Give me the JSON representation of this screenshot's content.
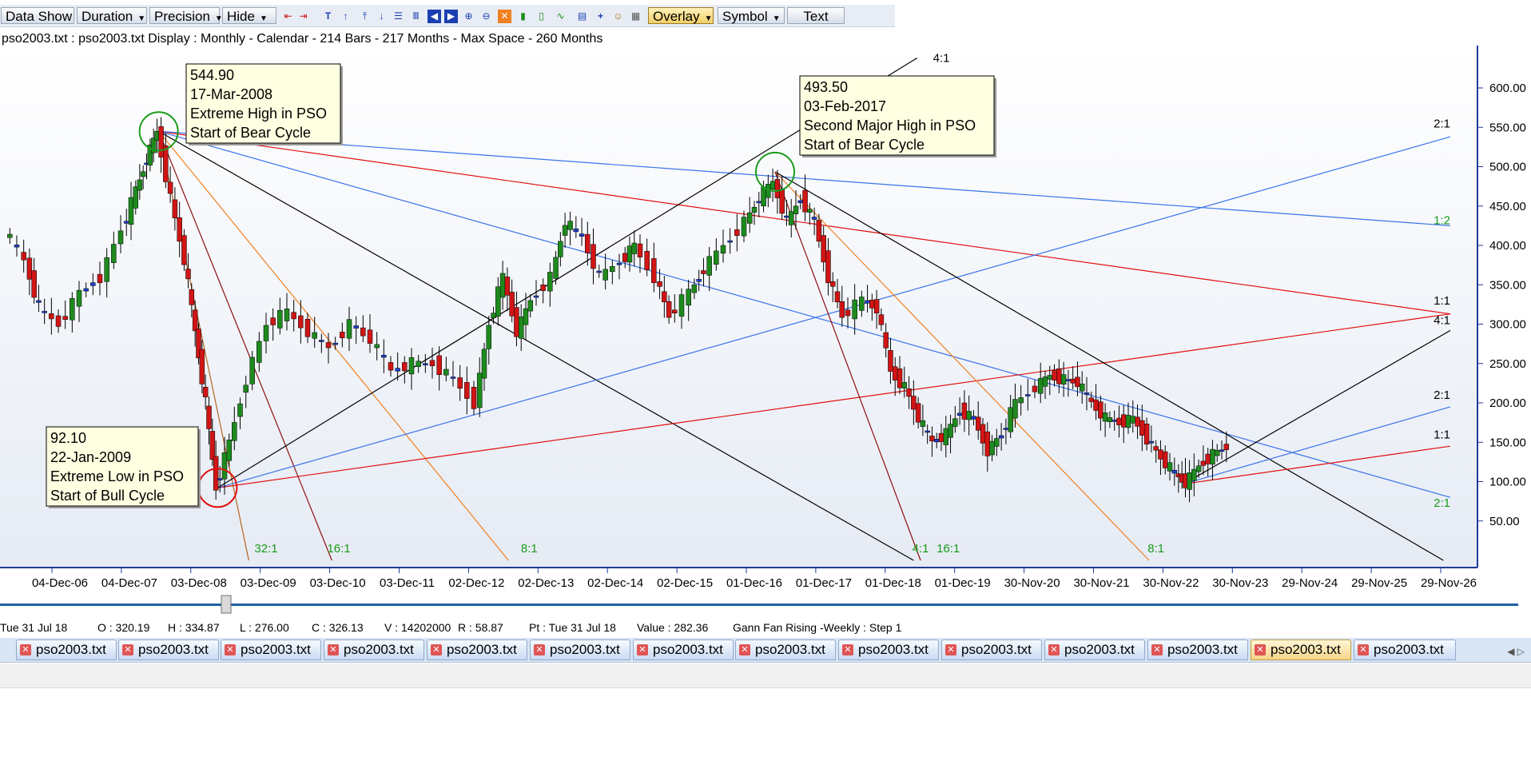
{
  "toolbar": {
    "data_show": "Data Show",
    "duration": "Duration",
    "precision": "Precision",
    "hide": "Hide",
    "overlay": "Overlay",
    "symbol": "Symbol",
    "text": "Text"
  },
  "info_line": "pso2003.txt : pso2003.txt Display :  Monthly  - Calendar - 214 Bars - 217 Months -  Max Space - 260 Months",
  "status": {
    "date": "Tue 31 Jul 18",
    "open": "O : 320.19",
    "high": "H : 334.87",
    "low": "L : 276.00",
    "close": "C : 326.13",
    "volume": "V : 14202000",
    "range": "R : 58.87",
    "pt": "Pt : Tue 31 Jul 18",
    "value": "Value : 282.36",
    "tool": "Gann Fan Rising -Weekly : Step 1"
  },
  "tabs": [
    "pso2003.txt",
    "pso2003.txt",
    "pso2003.txt",
    "pso2003.txt",
    "pso2003.txt",
    "pso2003.txt",
    "pso2003.txt",
    "pso2003.txt",
    "pso2003.txt",
    "pso2003.txt",
    "pso2003.txt",
    "pso2003.txt",
    "pso2003.txt",
    "pso2003.txt"
  ],
  "active_tab_index": 12,
  "chart_data": {
    "type": "candlestick",
    "symbol": "PSO",
    "ylim": [
      0,
      620
    ],
    "y_ticks": [
      50,
      100,
      150,
      200,
      250,
      300,
      350,
      400,
      450,
      500,
      550,
      600
    ],
    "y_tick_labels": [
      "50.00",
      "100.00",
      "150.00",
      "200.00",
      "250.00",
      "300.00",
      "350.00",
      "400.00",
      "450.00",
      "500.00",
      "550.00",
      "600.00"
    ],
    "x_tick_labels": [
      "04-Dec-06",
      "04-Dec-07",
      "03-Dec-08",
      "03-Dec-09",
      "03-Dec-10",
      "03-Dec-11",
      "02-Dec-12",
      "02-Dec-13",
      "02-Dec-14",
      "02-Dec-15",
      "01-Dec-16",
      "01-Dec-17",
      "01-Dec-18",
      "01-Dec-19",
      "30-Nov-20",
      "30-Nov-21",
      "30-Nov-22",
      "30-Nov-23",
      "29-Nov-24",
      "29-Nov-25",
      "29-Nov-26"
    ],
    "x_range": [
      2006.0,
      2027.0
    ],
    "colors": {
      "up": "#1e8a1e",
      "down": "#d01515",
      "doji": "#1f3fd0",
      "fan_black": "#000000",
      "fan_blue": "#3a73ea",
      "fan_red": "#e01010",
      "fan_orange": "#f08020",
      "fan_darkred": "#8b1010",
      "ratio_green": "#1a9a1a"
    },
    "callouts": [
      {
        "lines": [
          "544.90",
          "17-Mar-2008",
          "Extreme High in PSO",
          "Start of Bear Cycle"
        ],
        "t": 2008.2,
        "price": 544.9
      },
      {
        "lines": [
          "493.50",
          "03-Feb-2017",
          "Second Major High in PSO",
          "Start of Bear Cycle"
        ],
        "t": 2017.1,
        "price": 493.5
      },
      {
        "lines": [
          "92.10",
          "22-Jan-2009",
          "Extreme Low in PSO",
          "Start of Bull Cycle"
        ],
        "t": 2009.05,
        "price": 92.1
      }
    ],
    "pivot_circles": [
      {
        "t": 2008.2,
        "price": 544.9,
        "color": "#1a9a1a"
      },
      {
        "t": 2017.1,
        "price": 493.5,
        "color": "#1a9a1a"
      },
      {
        "t": 2009.05,
        "price": 92.1,
        "color": "#e01010"
      }
    ],
    "fan_lines": [
      {
        "from": [
          2008.2,
          544.9
        ],
        "to": [
          2026.85,
          313
        ],
        "color": "#e01010"
      },
      {
        "from": [
          2008.2,
          544.9
        ],
        "to": [
          2026.85,
          425
        ],
        "color": "#3a73ea"
      },
      {
        "from": [
          2008.2,
          544.9
        ],
        "to": [
          2026.85,
          80
        ],
        "color": "#3a73ea"
      },
      {
        "from": [
          2008.2,
          544.9
        ],
        "to": [
          2019.1,
          0
        ],
        "color": "#000000"
      },
      {
        "from": [
          2008.2,
          544.9
        ],
        "to": [
          2013.25,
          0
        ],
        "color": "#f08020"
      },
      {
        "from": [
          2008.2,
          544.9
        ],
        "to": [
          2010.7,
          0
        ],
        "color": "#8b1010"
      },
      {
        "from": [
          2008.2,
          544.9
        ],
        "to": [
          2009.5,
          0
        ],
        "color": "#b4641e"
      },
      {
        "from": [
          2009.05,
          92.1
        ],
        "to": [
          2026.85,
          313
        ],
        "color": "#e01010"
      },
      {
        "from": [
          2009.05,
          92.1
        ],
        "to": [
          2026.85,
          538
        ],
        "color": "#3a73ea"
      },
      {
        "from": [
          2009.05,
          92.1
        ],
        "to": [
          2019.15,
          638
        ],
        "color": "#000000"
      },
      {
        "from": [
          2017.1,
          493.5
        ],
        "to": [
          2026.75,
          0
        ],
        "color": "#000000"
      },
      {
        "from": [
          2017.1,
          493.5
        ],
        "to": [
          2022.5,
          0
        ],
        "color": "#f08020"
      },
      {
        "from": [
          2017.1,
          493.5
        ],
        "to": [
          2019.2,
          0
        ],
        "color": "#8b1010"
      },
      {
        "from": [
          2023.0,
          97
        ],
        "to": [
          2026.85,
          292
        ],
        "color": "#000000"
      },
      {
        "from": [
          2023.0,
          97
        ],
        "to": [
          2026.85,
          195
        ],
        "color": "#3a73ea"
      },
      {
        "from": [
          2023.0,
          97
        ],
        "to": [
          2026.85,
          145
        ],
        "color": "#e01010"
      }
    ],
    "ratio_labels": [
      {
        "text": "4:1",
        "t": 2019.5,
        "price": 633,
        "color": "#000000"
      },
      {
        "text": "2:1",
        "t": 2026.85,
        "price": 550,
        "color": "#000000"
      },
      {
        "text": "1:2",
        "t": 2026.85,
        "price": 427,
        "color": "#1a9a1a"
      },
      {
        "text": "1:1",
        "t": 2026.85,
        "price": 325,
        "color": "#000000"
      },
      {
        "text": "4:1",
        "t": 2026.85,
        "price": 300,
        "color": "#000000"
      },
      {
        "text": "2:1",
        "t": 2026.85,
        "price": 205,
        "color": "#000000"
      },
      {
        "text": "1:1",
        "t": 2026.85,
        "price": 155,
        "color": "#000000"
      },
      {
        "text": "2:1",
        "t": 2026.85,
        "price": 68,
        "color": "#1a9a1a"
      },
      {
        "text": "32:1",
        "t": 2009.75,
        "price": 10,
        "color": "#1a9a1a"
      },
      {
        "text": "16:1",
        "t": 2010.8,
        "price": 10,
        "color": "#1a9a1a"
      },
      {
        "text": "8:1",
        "t": 2013.55,
        "price": 10,
        "color": "#1a9a1a"
      },
      {
        "text": "4:1",
        "t": 2019.2,
        "price": 10,
        "color": "#1a9a1a"
      },
      {
        "text": "16:1",
        "t": 2019.6,
        "price": 10,
        "color": "#1a9a1a"
      },
      {
        "text": "8:1",
        "t": 2022.6,
        "price": 10,
        "color": "#1a9a1a"
      }
    ],
    "price_path": [
      [
        2006.0,
        420
      ],
      [
        2006.3,
        380
      ],
      [
        2006.5,
        320
      ],
      [
        2006.8,
        300
      ],
      [
        2007.1,
        340
      ],
      [
        2007.4,
        360
      ],
      [
        2007.7,
        420
      ],
      [
        2007.9,
        470
      ],
      [
        2008.05,
        510
      ],
      [
        2008.2,
        544.9
      ],
      [
        2008.4,
        460
      ],
      [
        2008.6,
        380
      ],
      [
        2008.75,
        290
      ],
      [
        2008.9,
        200
      ],
      [
        2009.05,
        92.1
      ],
      [
        2009.25,
        150
      ],
      [
        2009.5,
        230
      ],
      [
        2009.8,
        300
      ],
      [
        2010.1,
        315
      ],
      [
        2010.4,
        290
      ],
      [
        2010.7,
        270
      ],
      [
        2011.0,
        300
      ],
      [
        2011.3,
        280
      ],
      [
        2011.6,
        240
      ],
      [
        2011.9,
        250
      ],
      [
        2012.2,
        250
      ],
      [
        2012.5,
        230
      ],
      [
        2012.8,
        200
      ],
      [
        2013.0,
        300
      ],
      [
        2013.2,
        360
      ],
      [
        2013.4,
        290
      ],
      [
        2013.6,
        330
      ],
      [
        2013.9,
        360
      ],
      [
        2014.1,
        430
      ],
      [
        2014.35,
        410
      ],
      [
        2014.6,
        360
      ],
      [
        2014.9,
        380
      ],
      [
        2015.1,
        400
      ],
      [
        2015.4,
        360
      ],
      [
        2015.6,
        310
      ],
      [
        2015.9,
        340
      ],
      [
        2016.1,
        370
      ],
      [
        2016.4,
        400
      ],
      [
        2016.7,
        430
      ],
      [
        2016.9,
        460
      ],
      [
        2017.1,
        480
      ],
      [
        2017.3,
        430
      ],
      [
        2017.5,
        460
      ],
      [
        2017.7,
        430
      ],
      [
        2017.9,
        360
      ],
      [
        2018.1,
        310
      ],
      [
        2018.4,
        330
      ],
      [
        2018.6,
        320
      ],
      [
        2018.8,
        240
      ],
      [
        2019.0,
        220
      ],
      [
        2019.2,
        180
      ],
      [
        2019.4,
        150
      ],
      [
        2019.6,
        160
      ],
      [
        2019.8,
        190
      ],
      [
        2020.0,
        180
      ],
      [
        2020.2,
        140
      ],
      [
        2020.4,
        160
      ],
      [
        2020.6,
        200
      ],
      [
        2020.9,
        220
      ],
      [
        2021.1,
        235
      ],
      [
        2021.3,
        230
      ],
      [
        2021.5,
        225
      ],
      [
        2021.7,
        200
      ],
      [
        2021.9,
        180
      ],
      [
        2022.1,
        175
      ],
      [
        2022.3,
        180
      ],
      [
        2022.5,
        155
      ],
      [
        2022.7,
        130
      ],
      [
        2022.9,
        110
      ],
      [
        2023.05,
        98
      ],
      [
        2023.25,
        120
      ],
      [
        2023.45,
        135
      ],
      [
        2023.65,
        145
      ]
    ]
  }
}
